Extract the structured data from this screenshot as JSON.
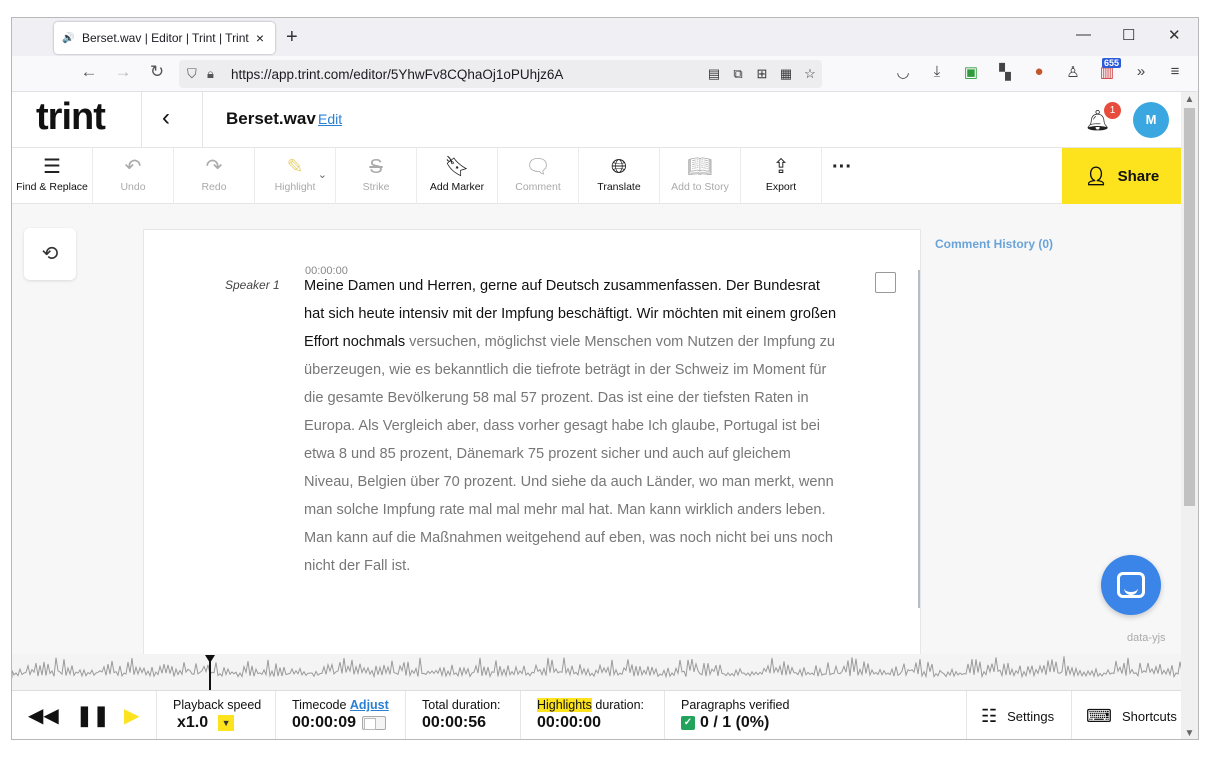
{
  "browser": {
    "tab_title": "Berset.wav | Editor | Trint | Trint",
    "url": "https://app.trint.com/editor/5YhwFv8CQhaOj1oPUhjz6A",
    "extension_badge": "655"
  },
  "header": {
    "logo": "trint",
    "file_name": "Berset.wav",
    "edit_label": "Edit",
    "notification_count": "1",
    "avatar_initial": "M"
  },
  "toolbar": {
    "find_replace": "Find & Replace",
    "undo": "Undo",
    "redo": "Redo",
    "highlight": "Highlight",
    "strike": "Strike",
    "add_marker": "Add Marker",
    "comment": "Comment",
    "translate": "Translate",
    "add_to_story": "Add to Story",
    "export": "Export",
    "more": "···",
    "share": "Share"
  },
  "transcript": {
    "timecode": "00:00:00",
    "speaker": "Speaker 1",
    "verified_text": "Meine Damen und Herren, gerne auf Deutsch zusammenfassen. Der Bundesrat hat sich heute intensiv mit der Impfung beschäftigt. Wir möchten mit einem großen Effort nochmals",
    "unverified_text": " versuchen, möglichst viele Menschen vom Nutzen der Impfung zu überzeugen, wie es bekanntlich die tiefrote beträgt in der Schweiz im Moment für die gesamte Bevölkerung 58 mal 57 prozent. Das ist eine der tiefsten Raten in Europa. Als Vergleich aber, dass vorher gesagt habe Ich glaube, Portugal ist bei etwa 8 und 85 prozent, Dänemark 75 prozent sicher und auch auf gleichem Niveau, Belgien über 70 prozent. Und siehe da auch Länder, wo man merkt, wenn man solche Impfung rate mal mal mehr mal hat. Man kann wirklich anders leben. Man kann auf die Maßnahmen weitgehend auf eben, was noch nicht bei uns noch nicht der Fall ist."
  },
  "sidebar": {
    "comment_history": "Comment History (0)",
    "footer_tag": "data-yjs"
  },
  "player": {
    "playback_speed_label": "Playback speed",
    "playback_speed_value": "x1.0",
    "timecode_label": "Timecode",
    "adjust_label": "Adjust",
    "timecode_value": "00:00:09",
    "total_duration_label": "Total duration:",
    "total_duration_value": "00:00:56",
    "highlights_label": "Highlights",
    "highlights_duration_label": " duration:",
    "highlights_duration_value": "00:00:00",
    "paragraphs_verified_label": "Paragraphs verified",
    "paragraphs_verified_value": "0 / 1 (0%)",
    "settings": "Settings",
    "shortcuts": "Shortcuts"
  },
  "colors": {
    "accent_yellow": "#fce31d",
    "link_blue": "#2a7fd4",
    "avatar_blue": "#3aa7e0",
    "chat_blue": "#3b84e8",
    "verified_green": "#21a35a"
  },
  "icons": [
    "speaker-icon",
    "close-icon",
    "new-tab-icon",
    "back-icon",
    "forward-icon",
    "reload-icon",
    "shield-icon",
    "lock-icon",
    "reader-icon",
    "bookmark-star-icon",
    "bell-icon",
    "find-replace-icon",
    "undo-icon",
    "redo-icon",
    "highlight-pen-icon",
    "strike-icon",
    "marker-icon",
    "comment-icon",
    "translate-icon",
    "story-icon",
    "export-icon",
    "share-person-icon",
    "history-icon",
    "rewind-icon",
    "pause-icon",
    "play-icon",
    "settings-sliders-icon",
    "keyboard-icon",
    "chat-icon"
  ]
}
